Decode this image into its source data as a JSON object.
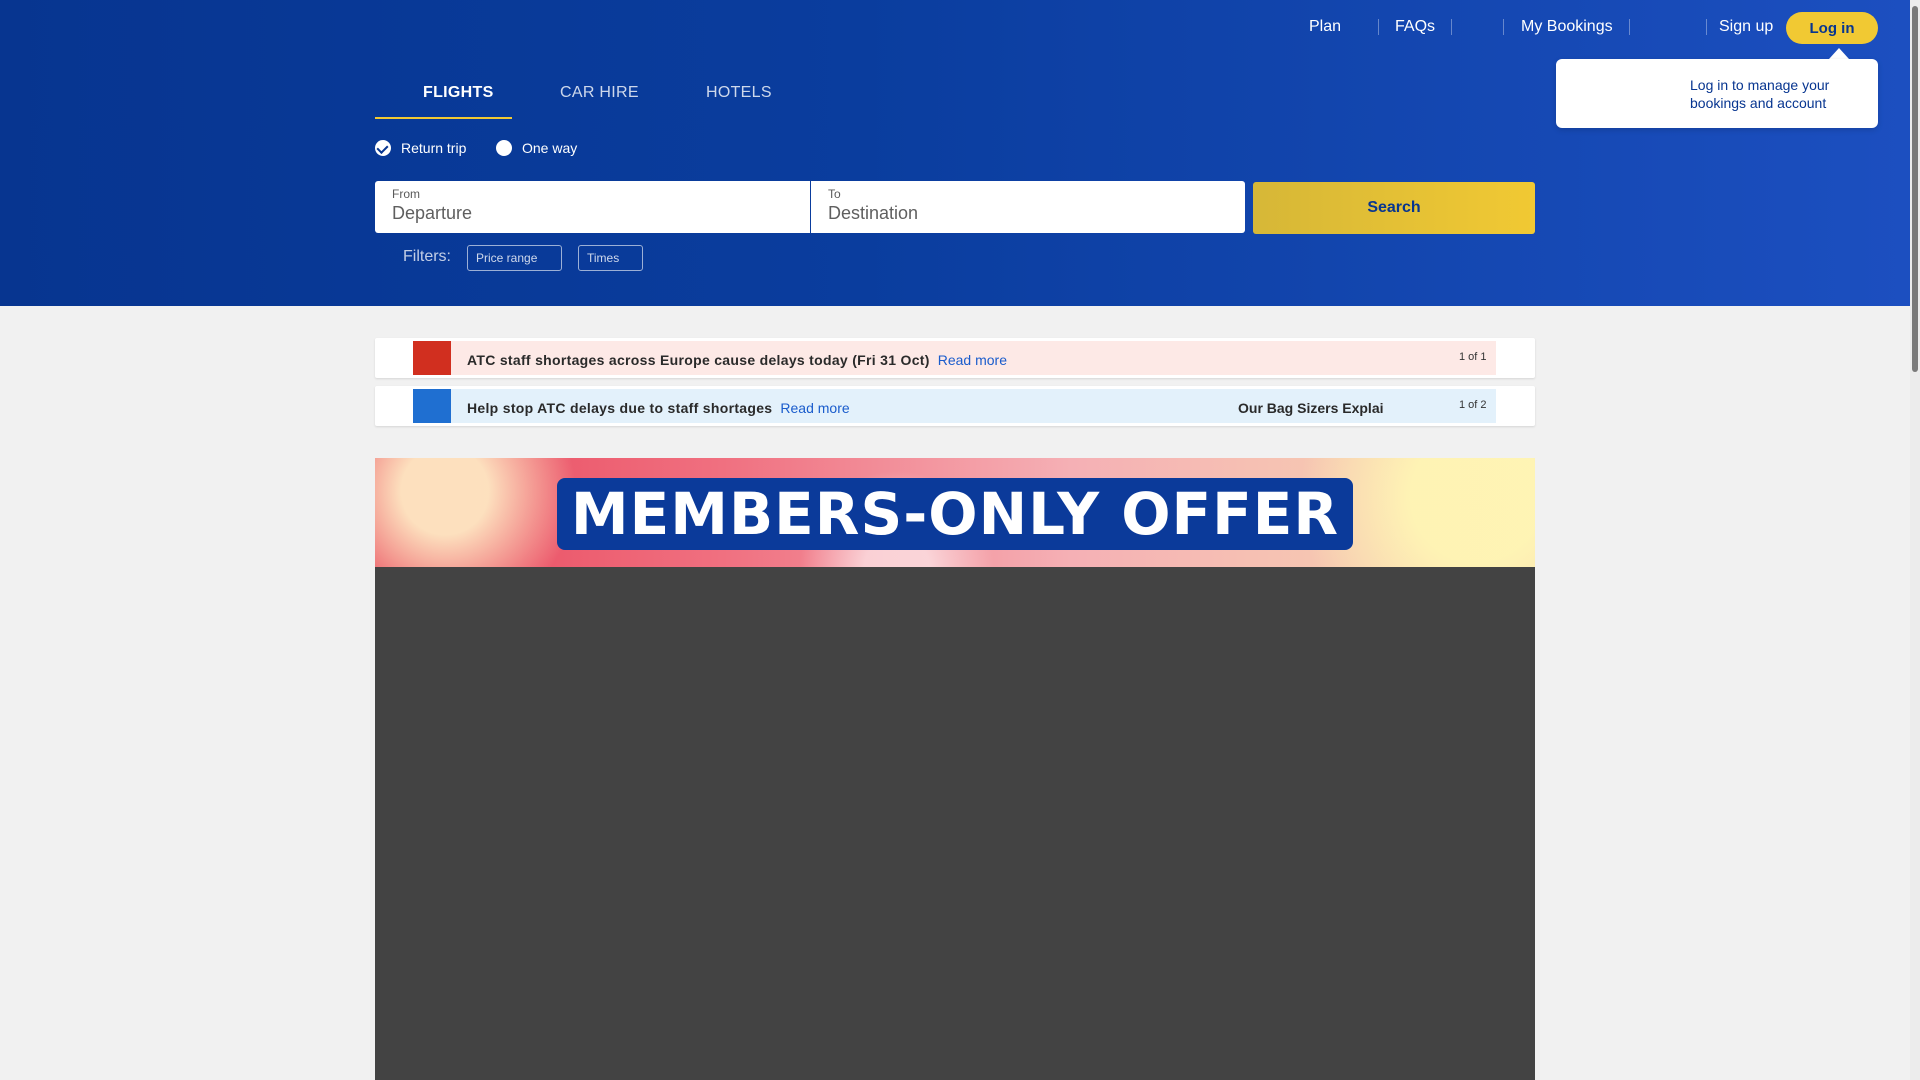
{
  "nav": {
    "plan": "Plan",
    "faqs": "FAQs",
    "my_bookings": "My Bookings",
    "sign_up": "Sign up",
    "log_in": "Log in"
  },
  "tooltip": {
    "text": "Log in to manage your bookings and account"
  },
  "tabs": [
    {
      "label": "FLIGHTS",
      "active": true
    },
    {
      "label": "CAR HIRE",
      "active": false
    },
    {
      "label": "HOTELS",
      "active": false
    }
  ],
  "trip_type": {
    "return_trip": "Return trip",
    "one_way": "One way",
    "selected": "return_trip"
  },
  "search": {
    "from_label": "From",
    "from_placeholder": "Departure",
    "to_label": "To",
    "to_placeholder": "Destination",
    "button": "Search"
  },
  "filters": {
    "label": "Filters:",
    "price_range": "Price range",
    "times": "Times"
  },
  "alerts": [
    {
      "text": "ATC staff shortages across Europe cause delays today (Fri 31 Oct)",
      "link": "Read more",
      "count": "1 of 1",
      "color": "#d12f1f"
    },
    {
      "text": "Help stop ATC delays due to staff shortages",
      "link": "Read more",
      "extra": "Our Bag Sizers Explai",
      "count": "1 of 2",
      "color": "#1f6fd1"
    }
  ],
  "banner": {
    "title": "MEMBERS-ONLY OFFER"
  },
  "colors": {
    "brand_blue": "#073590",
    "accent_yellow": "#f1c933"
  }
}
